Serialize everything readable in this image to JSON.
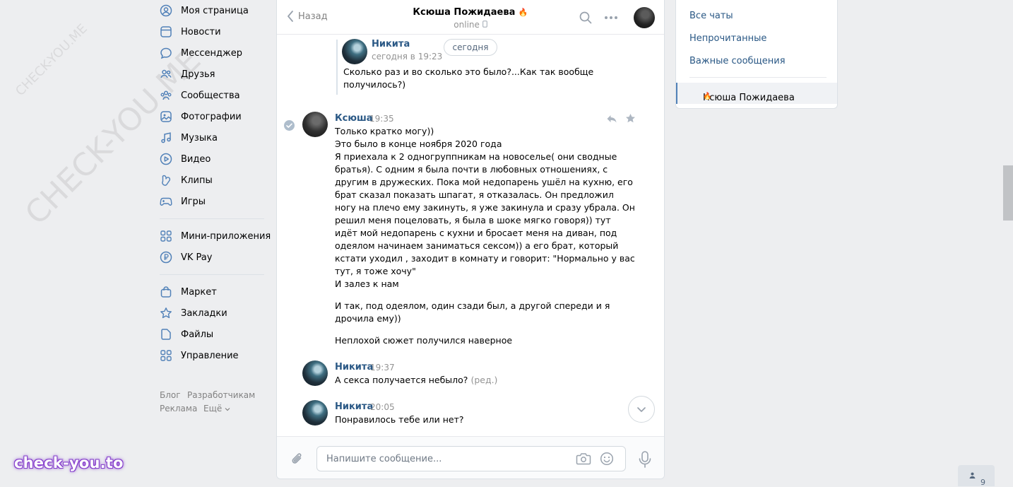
{
  "nav": {
    "items": [
      {
        "label": "Моя страница",
        "icon": "user-icon"
      },
      {
        "label": "Новости",
        "icon": "news-icon"
      },
      {
        "label": "Мессенджер",
        "icon": "messenger-icon"
      },
      {
        "label": "Друзья",
        "icon": "friends-icon"
      },
      {
        "label": "Сообщества",
        "icon": "communities-icon"
      },
      {
        "label": "Фотографии",
        "icon": "photos-icon"
      },
      {
        "label": "Музыка",
        "icon": "music-icon"
      },
      {
        "label": "Видео",
        "icon": "video-icon"
      },
      {
        "label": "Клипы",
        "icon": "clips-icon"
      },
      {
        "label": "Игры",
        "icon": "games-icon"
      },
      {
        "label": "Мини-приложения",
        "icon": "apps-icon"
      },
      {
        "label": "VK Pay",
        "icon": "vkpay-icon"
      },
      {
        "label": "Маркет",
        "icon": "market-icon"
      },
      {
        "label": "Закладки",
        "icon": "bookmark-icon"
      },
      {
        "label": "Файлы",
        "icon": "file-icon"
      },
      {
        "label": "Управление",
        "icon": "manage-icon"
      }
    ],
    "footer": {
      "blog": "Блог",
      "developers": "Разработчикам",
      "ads": "Реклама",
      "more": "Ещё"
    }
  },
  "watermark": {
    "text": "CHECK-YOU.ME",
    "brand": "check-you.to"
  },
  "chat": {
    "header": {
      "back_label": "Назад",
      "peer_name": "Ксюша Пожидаева",
      "peer_badge": "🔥",
      "status": "online"
    },
    "forwarded": {
      "author": "Никита",
      "time": "сегодня в 19:23",
      "lines": [
        "Сколько раз и во сколько это было?...Как так вообще",
        "получилось?)"
      ]
    },
    "date_pill": "сегодня",
    "messages": [
      {
        "author": "Ксюша",
        "time": "19:35",
        "lines": [
          "Только кратко могу))",
          "Это было в конце ноября 2020 года",
          "Я приехала к 2 одногруппникам на новоселье( они сводные",
          "братья). С одним я была почти в любовных отношениях, с",
          "другим в дружеских. Пока мой недопарень ушёл на кухню, его",
          "брат сказал показать шпагат, я отказалась. Он предложил",
          "ногу на плечо ему закинуть, я уже закинула и сразу убрала. Он",
          "решил меня поцеловать, я была в шоке мягко говоря)) тут",
          "идёт мой недопарень с кухни и бросает меня на диван, под",
          "одеялом начинаем заниматься сексом)) а его брат, который",
          "кстати уходил , заходит в комнату и говорит: \"Нормально у вас",
          "тут, я тоже хочу\"",
          "И залез к нам"
        ],
        "para2": [
          "И так, под одеялом, один сзади был, а другой спереди и я",
          "дрочила ему))"
        ],
        "para3": "Неплохой сюжет получился наверное"
      },
      {
        "author": "Никита",
        "time": "19:37",
        "text": "А секса получается небыло?",
        "edited": "(ред.)"
      },
      {
        "author": "Никита",
        "time": "20:05",
        "text": "Понравилось тебе или нет?"
      }
    ],
    "input_placeholder": "Напишите сообщение..."
  },
  "right_panel": {
    "links": [
      "Все чаты",
      "Непрочитанные",
      "Важные сообщения"
    ],
    "active_chat": "Ксюша Пожидаева",
    "active_badge": "🔥"
  },
  "online_count": "9"
}
